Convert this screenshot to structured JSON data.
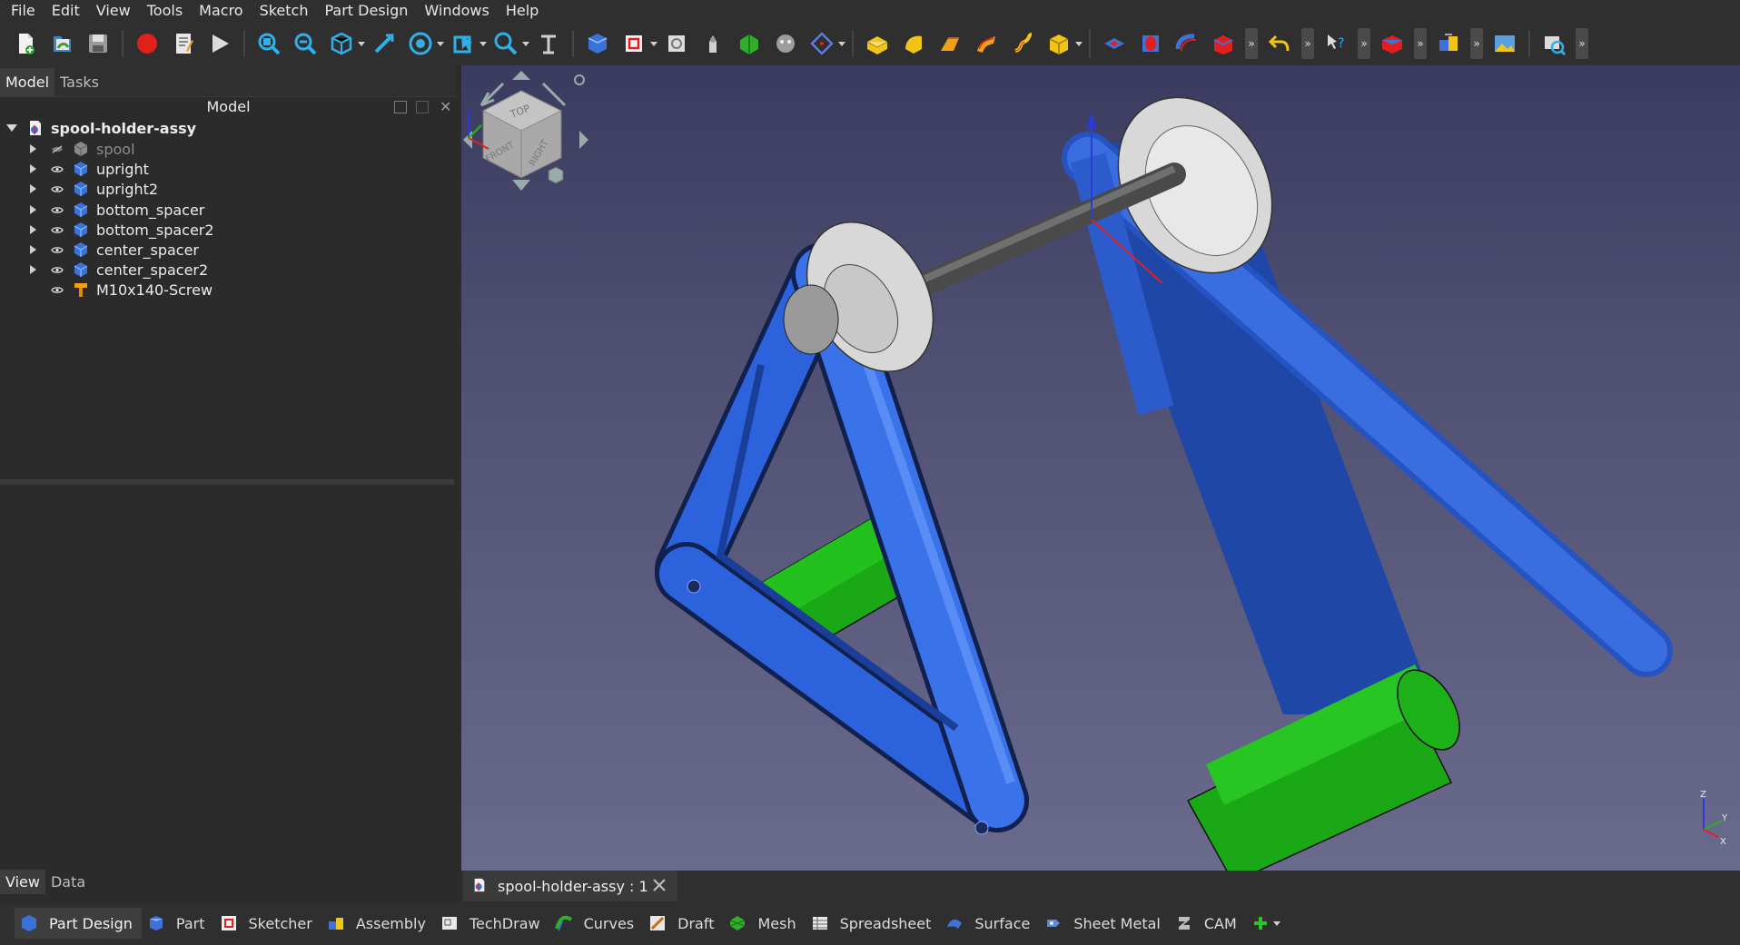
{
  "menubar": {
    "items": [
      "File",
      "Edit",
      "View",
      "Tools",
      "Macro",
      "Sketch",
      "Part Design",
      "Windows",
      "Help"
    ]
  },
  "toolbar": {
    "icons": [
      "new-document-icon",
      "open-document-icon",
      "save-icon",
      "record-macro-icon",
      "macro-editor-icon",
      "execute-macro-icon",
      "fit-all-icon",
      "fit-selection-icon",
      "isometric-view-icon",
      "measure-icon",
      "draw-style-icon",
      "selection-view-icon",
      "zoom-icon",
      "measure-distance-icon",
      "create-body-icon",
      "create-sketch-icon",
      "validate-sketch-icon",
      "attachment-icon",
      "shape-binder-icon",
      "clone-icon",
      "datum-plane-icon",
      "pad-icon",
      "revolution-icon",
      "loft-icon",
      "pipe-icon",
      "helix-icon",
      "additive-primitive-icon",
      "pocket-icon",
      "hole-icon",
      "groove-icon",
      "subtractive-loft-icon",
      "undo-icon",
      "whats-this-icon",
      "part-box-icon",
      "assembly-icon",
      "image-icon",
      "screenshot-icon"
    ]
  },
  "panel": {
    "tabs": [
      "Model",
      "Tasks"
    ],
    "header": "Model"
  },
  "tree": {
    "root": "spool-holder-assy",
    "items": [
      {
        "label": "spool",
        "hidden": true
      },
      {
        "label": "upright",
        "hidden": false
      },
      {
        "label": "upright2",
        "hidden": false
      },
      {
        "label": "bottom_spacer",
        "hidden": false
      },
      {
        "label": "bottom_spacer2",
        "hidden": false
      },
      {
        "label": "center_spacer",
        "hidden": false
      },
      {
        "label": "center_spacer2",
        "hidden": false
      },
      {
        "label": "M10x140-Screw",
        "hidden": false
      }
    ]
  },
  "property_tabs": [
    "View",
    "Data"
  ],
  "document": {
    "tab_label": "spool-holder-assy : 1"
  },
  "navcube": {
    "faces": [
      "TOP",
      "FRONT",
      "RIGHT"
    ]
  },
  "axis_labels": [
    "Z",
    "Y",
    "X"
  ],
  "workbenches": [
    "Part Design",
    "Part",
    "Sketcher",
    "Assembly",
    "TechDraw",
    "Curves",
    "Draft",
    "Mesh",
    "Spreadsheet",
    "Surface",
    "Sheet Metal",
    "CAM"
  ],
  "colors": {
    "frame_blue": "#2f63d8",
    "spacer_green": "#17a313",
    "spool_grey": "#d4d4d4",
    "viewport_top": "#3b3b60",
    "viewport_bottom": "#6a6a8d"
  }
}
